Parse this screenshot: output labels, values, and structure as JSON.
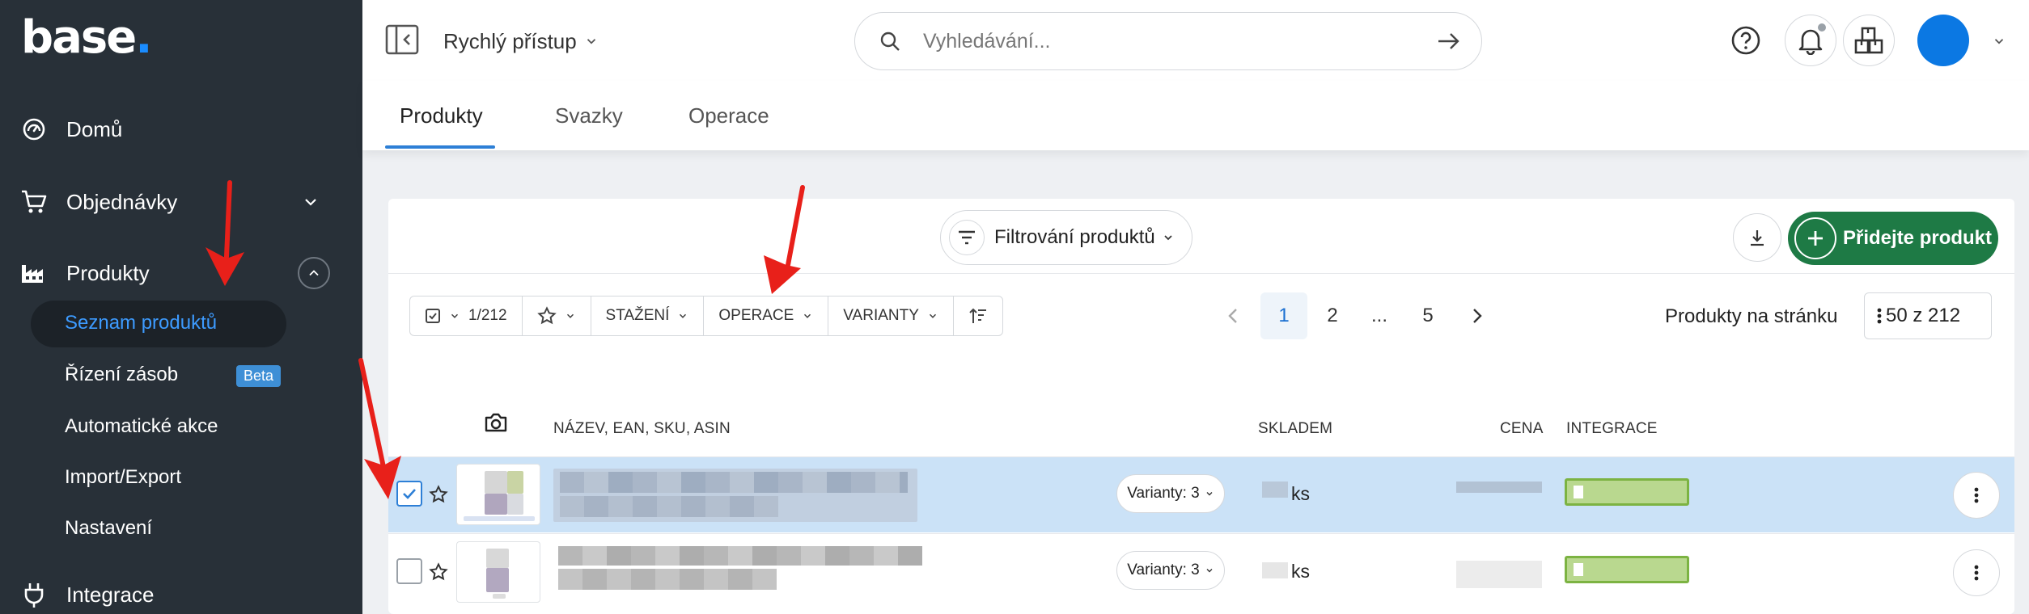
{
  "sidebar": {
    "logo": "base",
    "logo_dot": ".",
    "items": [
      {
        "label": "Domů",
        "icon": "dashboard-gauge-icon"
      },
      {
        "label": "Objednávky",
        "icon": "cart-icon"
      },
      {
        "label": "Produkty",
        "icon": "factory-icon"
      },
      {
        "label": "Integrace",
        "icon": "plug-icon"
      }
    ],
    "sub_items": [
      {
        "label": "Seznam produktů",
        "active": true
      },
      {
        "label": "Řízení zásob",
        "badge": "Beta"
      },
      {
        "label": "Automatické akce"
      },
      {
        "label": "Import/Export"
      },
      {
        "label": "Nastavení"
      }
    ]
  },
  "header": {
    "quick_access": "Rychlý přístup",
    "search_placeholder": "Vyhledávání...",
    "icons": [
      "help-icon",
      "bell-icon",
      "boxes-icon"
    ],
    "avatar_color": "#0b78e3"
  },
  "tabs": [
    {
      "label": "Produkty",
      "active": true
    },
    {
      "label": "Svazky"
    },
    {
      "label": "Operace"
    }
  ],
  "toolbar": {
    "filter_label": "Filtrování produktů",
    "add_label": "Přidejte produkt",
    "selection": "1/212",
    "download_label": "STAŽENÍ",
    "operations_label": "OPERACE",
    "variants_label": "VARIANTY",
    "pages": [
      "1",
      "2",
      "...",
      "5"
    ],
    "current_page": "1",
    "per_page_label": "Produkty na stránku",
    "per_page_value": "50 z 212"
  },
  "table": {
    "columns": [
      "NÁZEV, EAN, SKU, ASIN",
      "SKLADEM",
      "CENA",
      "INTEGRACE"
    ],
    "rows": [
      {
        "selected": true,
        "variants": "Varianty: 3",
        "stock_unit": "ks"
      },
      {
        "selected": false,
        "variants": "Varianty: 3",
        "stock_unit": "ks"
      }
    ]
  },
  "colors": {
    "sidebar_bg": "#283038",
    "accent": "#2d7fd6",
    "add_button": "#1e7a45",
    "selected_row": "#cbe2f7",
    "integration_green": "#7cb342",
    "annotation_arrow": "#e8201a"
  }
}
